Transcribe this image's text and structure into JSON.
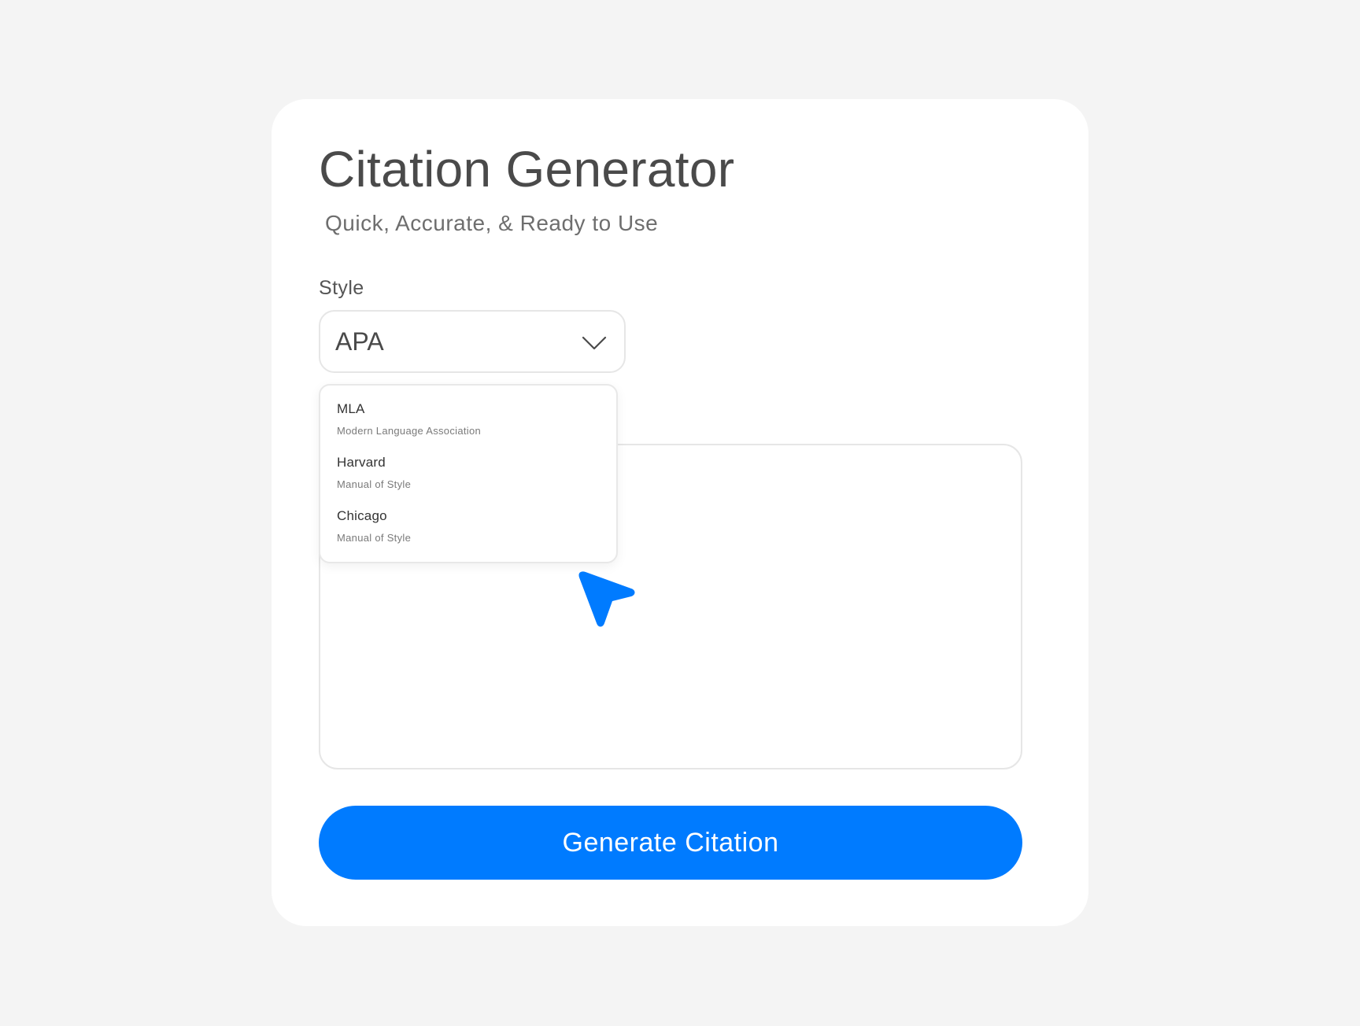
{
  "header": {
    "title": "Citation Generator",
    "subtitle": "Quick, Accurate, & Ready to Use"
  },
  "style_field": {
    "label": "Style",
    "selected": "APA",
    "options": [
      {
        "name": "MLA",
        "description": "Modern Language Association"
      },
      {
        "name": "Harvard",
        "description": "Manual of Style"
      },
      {
        "name": "Chicago",
        "description": "Manual of Style"
      }
    ]
  },
  "source_input": {
    "value": ""
  },
  "actions": {
    "generate_label": "Generate Citation"
  },
  "icons": {
    "select": "chevron-down-icon",
    "pointer": "cursor-arrow-icon"
  },
  "colors": {
    "background": "#f4f4f4",
    "card": "#ffffff",
    "accent": "#007bff",
    "heading": "#4a4a4a",
    "border": "#e6e6e6"
  }
}
